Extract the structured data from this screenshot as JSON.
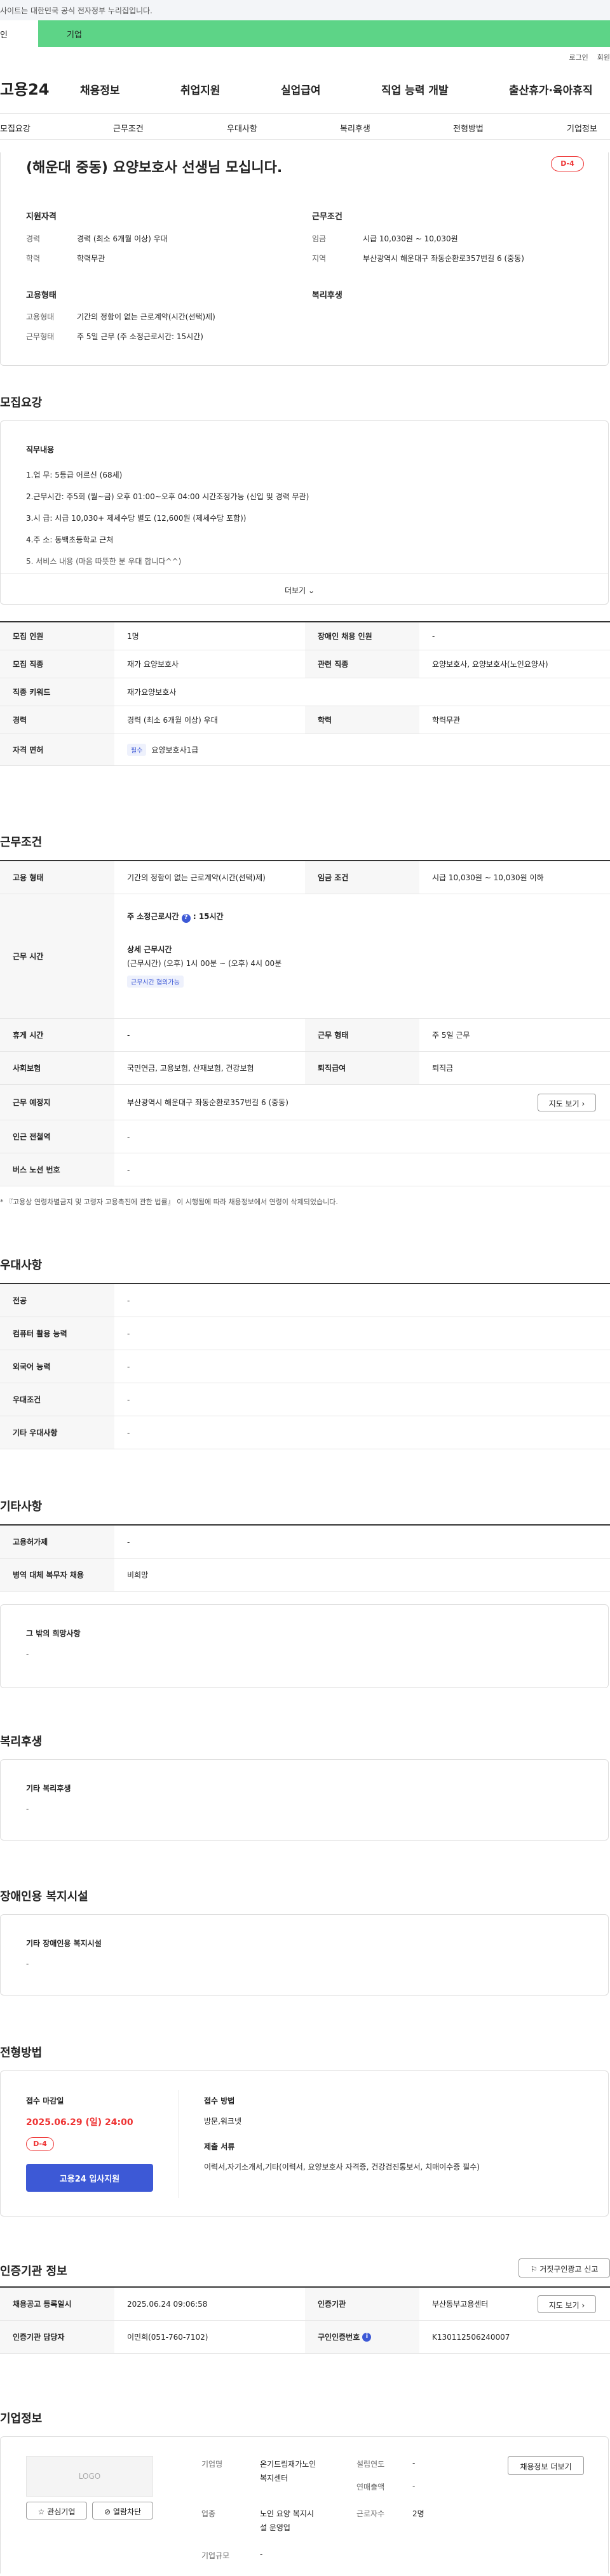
{
  "gov": {
    "notice": "사이트는 대한민국 공식 전자정부 누리집입니다."
  },
  "tabs": [
    "인",
    "기업"
  ],
  "util": [
    "로그인",
    "회원"
  ],
  "logo": "고용24",
  "gnb": [
    "채용정보",
    "취업지원",
    "실업급여",
    "직업 능력 개발",
    "출산휴가·육아휴직"
  ],
  "lnb": [
    "모집요강",
    "근무조건",
    "우대사항",
    "복리후생",
    "전형방법",
    "기업정보"
  ],
  "job": {
    "title": "(해운대 중동) 요양보호사 선생님 모십니다.",
    "dday": "D-4",
    "sec1": "지원자격",
    "sec2": "근무조건",
    "sec3": "고용형태",
    "sec4": "복리후생",
    "k1": "경력",
    "v1": "경력 (최소 6개월 이상) 우대",
    "k2": "학력",
    "v2": "학력무관",
    "k3": "임금",
    "v3": "시급 10,030원 ~ 10,030원",
    "k4": "지역",
    "v4": "부산광역시 해운대구 좌동순환로357번길 6 (중동)",
    "k5": "고용형태",
    "v5": "기간의 정함이 없는 근로계약(시간(선택)제)",
    "k6": "근무형태",
    "v6": "주 5일 근무 (주 소정근로시간: 15시간)"
  },
  "recruit": {
    "h": "모집요강",
    "dh": "직무내용",
    "lines": [
      "1.업      무:  5등급 어르신 (68세)",
      "2.근무시간: 주5회 (월~금) 오후 01:00~오후 04:00 시간조정가능 (신입 및 경력 무관)",
      "3.시      급: 시급 10,030+ 제세수당 별도 (12,600원 (제세수당 포함))",
      "4.주      소:  동백초등학교 근처",
      "5. 서비스 내용 (마음 따뜻한 분 우대 합니다^^)"
    ],
    "more": "더보기",
    "r1k": "모집 인원",
    "r1v": "1명",
    "r1k2": "장애인 채용 인원",
    "r1v2": "-",
    "r2k": "모집 직종",
    "r2v": "재가 요양보호사",
    "r2k2": "관련 직종",
    "r2v2": "요양보호사, 요양보호사(노인요양사)",
    "r3k": "직종 키워드",
    "r3v": "재가요양보호사",
    "r4k": "경력",
    "r4v": "경력 (최소 6개월 이상) 우대",
    "r4k2": "학력",
    "r4v2": "학력무관",
    "r5k": "자격 면허",
    "r5b": "필수",
    "r5v": "요양보호사1급"
  },
  "cond": {
    "h": "근무조건",
    "c1k": "고용 형태",
    "c1v": "기간의 정함이 없는 근로계약(시간(선택)제)",
    "c1k2": "임금 조건",
    "c1v2": "시급 10,030원 ~ 10,030원 이하",
    "c2k": "근무 시간",
    "c2a": "주 소정근로시간",
    "c2b": "15시간",
    "c2c": "상세 근무시간",
    "c2d": "(근무시간) (오후) 1시 00분 ~ (오후) 4시 00분",
    "c2e": "근무시간 협의가능",
    "c3k": "휴게 시간",
    "c3v": "-",
    "c3k2": "근무 형태",
    "c3v2": "주 5일 근무",
    "c4k": "사회보험",
    "c4v": "국민연금, 고용보험, 산재보험, 건강보험",
    "c4k2": "퇴직급여",
    "c4v2": "퇴직금",
    "c5k": "근무 예정지",
    "c5v": "부산광역시 해운대구 좌동순환로357번길 6 (중동)",
    "c5b": "지도 보기",
    "c6k": "인근 전철역",
    "c6v": "-",
    "c7k": "버스 노선 번호",
    "c7v": "-",
    "note": "* 『고용상 연령차별금지 및 고령자 고용촉진에 관한 법률』 이 시행됨에 따라 채용정보에서 연령이 삭제되었습니다."
  },
  "pref": {
    "h": "우대사항",
    "rows": [
      [
        "전공",
        "-"
      ],
      [
        "컴퓨터 활용 능력",
        "-"
      ],
      [
        "외국어 능력",
        "-"
      ],
      [
        "우대조건",
        "-"
      ],
      [
        "기타 우대사항",
        "-"
      ]
    ]
  },
  "etc": {
    "h": "기타사항",
    "rows": [
      [
        "고용허가제",
        "-"
      ],
      [
        "병역 대체 복무자 채용",
        "비희망"
      ]
    ],
    "bh": "그 밖의 희망사항",
    "bv": "-"
  },
  "welf": {
    "h": "복리후생",
    "bh": "기타 복리후생",
    "bv": "-"
  },
  "dis": {
    "h": "장애인용 복지시설",
    "bh": "기타 장애인용 복지시설",
    "bv": "-"
  },
  "sel": {
    "h": "전형방법",
    "dl": "접수 마감일",
    "date": "2025.06.29 (일) 24:00",
    "dday": "D-4",
    "apply": "고용24 입사지원",
    "mk": "접수 방법",
    "mv": "방문,워크넷",
    "dk": "제출 서류",
    "dv": "이력서,자기소개서,기타(이력서, 요양보호사 자격증, 건강검진통보서, 치매이수증 필수)"
  },
  "org": {
    "h": "인증기관 정보",
    "report": "거짓구인광고 신고",
    "o1k": "채용공고 등록일시",
    "o1v": "2025.06.24 09:06:58",
    "o1k2": "인증기관",
    "o1v2": "부산동부고용센터",
    "o1b": "지도 보기",
    "o2k": "인증기관 담당자",
    "o2v": "이민희(051-760-7102)",
    "o2k2": "구인인증번호",
    "o2v2": "K130112506240007"
  },
  "comp": {
    "h": "기업정보",
    "logo": "LOGO",
    "like": "관심기업",
    "block": "열람차단",
    "k1": "기업명",
    "v1a": "온기드림재가노인",
    "v1b": "복지센터",
    "k2": "업종",
    "v2a": "노인 요양 복지시",
    "v2b": "설 운영업",
    "k3": "기업규모",
    "v3": "-",
    "k4": "설립연도",
    "v4": "-",
    "k5": "연매출액",
    "v5": "-",
    "k6": "근로자수",
    "v6": "2명",
    "btn": "채용정보 더보기"
  }
}
